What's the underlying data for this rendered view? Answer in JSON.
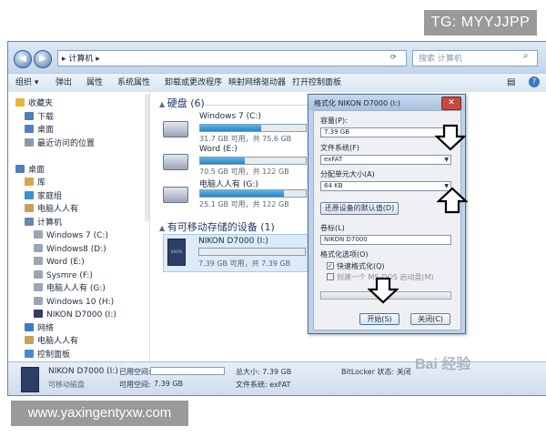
{
  "watermarks": {
    "top": "TG: MYYJJPP",
    "bottom": "www.yaxingentyxw.com",
    "logo": "Bai 经验"
  },
  "window": {
    "address": "▸ 计算机 ▸",
    "search_placeholder": "搜索 计算机",
    "toolbar": [
      "组织 ▾",
      "弹出",
      "属性",
      "系统属性",
      "卸载或更改程序",
      "映射网络驱动器",
      "打开控制面板"
    ]
  },
  "nav": {
    "items": [
      {
        "label": "收藏夹",
        "indent": 0,
        "color": "#e9b53a"
      },
      {
        "label": "下载",
        "indent": 1,
        "color": "#4f7fbf"
      },
      {
        "label": "桌面",
        "indent": 1,
        "color": "#4f7fbf"
      },
      {
        "label": "最近访问的位置",
        "indent": 1,
        "color": "#8a9aad"
      },
      {
        "label": "",
        "indent": 0,
        "color": ""
      },
      {
        "label": "桌面",
        "indent": 0,
        "color": "#4f7fbf"
      },
      {
        "label": "库",
        "indent": 1,
        "color": "#d7a64a"
      },
      {
        "label": "家庭组",
        "indent": 1,
        "color": "#3c8fd1"
      },
      {
        "label": "电脑人人有",
        "indent": 1,
        "color": "#c9a055"
      },
      {
        "label": "计算机",
        "indent": 1,
        "color": "#6a86aa"
      },
      {
        "label": "Windows 7 (C:)",
        "indent": 2,
        "color": "#9aa6b5"
      },
      {
        "label": "Windows8 (D:)",
        "indent": 2,
        "color": "#9aa6b5"
      },
      {
        "label": "Word (E:)",
        "indent": 2,
        "color": "#9aa6b5"
      },
      {
        "label": "Sysmre (F:)",
        "indent": 2,
        "color": "#9aa6b5"
      },
      {
        "label": "电脑人人有 (G:)",
        "indent": 2,
        "color": "#9aa6b5"
      },
      {
        "label": "Windows 10 (H:)",
        "indent": 2,
        "color": "#9aa6b5"
      },
      {
        "label": "NIKON D7000 (I:)",
        "indent": 2,
        "color": "#2d3f66"
      },
      {
        "label": "网络",
        "indent": 1,
        "color": "#3c7cc4"
      },
      {
        "label": "电脑人人有",
        "indent": 1,
        "color": "#c9a055"
      },
      {
        "label": "控制面板",
        "indent": 1,
        "color": "#4a8bd0"
      }
    ]
  },
  "content": {
    "hdd_group": "硬盘 (6)",
    "drives": [
      {
        "name": "Windows 7 (C:)",
        "meta": "31.7 GB 可用，共 75.6 GB",
        "fill": 0.58
      },
      {
        "name": "Word (E:)",
        "meta": "70.5 GB 可用，共 122 GB",
        "fill": 0.42
      },
      {
        "name": "电脑人人有 (G:)",
        "meta": "25.1 GB 可用，共 122 GB",
        "fill": 0.79
      }
    ],
    "removable_group": "有可移动存储的设备 (1)",
    "removable": {
      "name": "NIKON D7000 (I:)",
      "meta": "7.39 GB 可用，共 7.39 GB",
      "fill": 0.0,
      "icon_text": "NIKON"
    }
  },
  "status": {
    "name": "NIKON D7000 (I:)",
    "type": "可移动磁盘",
    "used_label": "已用空间:",
    "free_label": "可用空间:",
    "free_value": "7.39 GB",
    "total_label": "总大小: 7.39 GB",
    "fs_label": "文件系统: exFAT",
    "bitlocker": "BitLocker 状态: 关闭"
  },
  "dialog": {
    "title": "格式化 NIKON D7000 (I:)",
    "capacity_label": "容量(P):",
    "capacity_value": "7.39 GB",
    "fs_label": "文件系统(F)",
    "fs_value": "exFAT",
    "alloc_label": "分配单元大小(A)",
    "alloc_value": "64 KB",
    "restore_button": "还原设备的默认值(D)",
    "volume_label": "卷标(L)",
    "volume_value": "NIKON D7000",
    "options_label": "格式化选项(O)",
    "quick_format": "快速格式化(Q)",
    "msdos_disk": "创建一个 MS-DOS 启动盘(M)",
    "start_button": "开始(S)",
    "close_button": "关闭(C)",
    "quick_checked": "✓"
  }
}
